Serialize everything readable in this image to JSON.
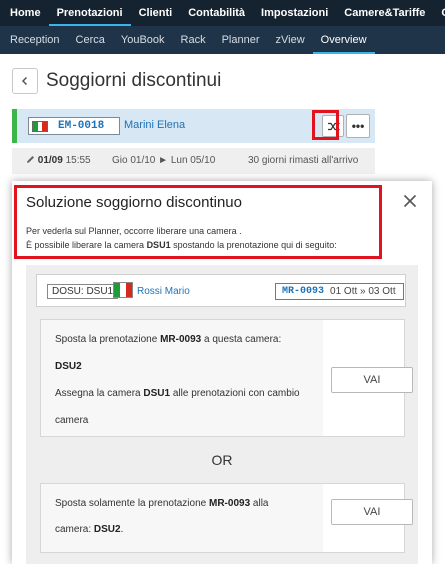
{
  "top_nav": [
    "Home",
    "Prenotazioni",
    "Clienti",
    "Contabilità",
    "Impostazioni",
    "Camere&Tariffe",
    "OnLine"
  ],
  "top_nav_active": "Prenotazioni",
  "sub_nav": [
    "Reception",
    "Cerca",
    "YouBook",
    "Rack",
    "Planner",
    "zView",
    "Overview"
  ],
  "sub_nav_active": "Overview",
  "page": {
    "title": "Soggiorni discontinui",
    "back_icon": "chevron-left-icon"
  },
  "booking": {
    "code": "EM-0018",
    "guest": "Marini Elena",
    "flag": "italy-flag",
    "arrival_date": "01/09",
    "arrival_time": "15:55",
    "stay_range": "Gio 01/10 ► Lun 05/10",
    "days_left": "30 giorni rimasti all'arrivo",
    "actions": {
      "swap_icon": "shuffle-icon",
      "more_label": "•••"
    }
  },
  "modal": {
    "title": "Soluzione soggiorno discontinuo",
    "close_icon": "close-icon",
    "message_line1": "Per vederla sul Planner, occorre liberare una camera .",
    "message_line2_pre": "È possibile liberare la camera ",
    "message_line2_room": "DSU1",
    "message_line2_post": " spostando la prenotazione qui di seguito:",
    "dosu": {
      "tag": "DOSU: DSU1",
      "guest": "Rossi Mario",
      "booking_code": "MR-0093",
      "dates": "01 Ott » 03 Ott"
    },
    "option_a": {
      "line1_pre": "Sposta la prenotazione ",
      "line1_code": "MR-0093",
      "line1_post": " a questa camera:",
      "room": "DSU2",
      "line3_pre": "Assegna la camera ",
      "line3_room": "DSU1",
      "line3_post": " alle prenotazioni con cambio",
      "line4": "camera",
      "button": "VAI"
    },
    "or_label": "OR",
    "option_b": {
      "line1_pre": "Sposta solamente la prenotazione ",
      "line1_code": "MR-0093",
      "line1_post": " alla",
      "line2_pre": "camera: ",
      "line2_room": "DSU2",
      "line2_post": ".",
      "button": "VAI"
    }
  },
  "colors": {
    "nav_bg": "#152230",
    "subnav_bg": "#1f3448",
    "active_underline": "#3ab5e6",
    "link_blue": "#1f73b7",
    "booking_bar_bg": "#d7e7f3",
    "booking_bar_accent": "#3cb54a",
    "highlight_red": "#e0141e"
  }
}
